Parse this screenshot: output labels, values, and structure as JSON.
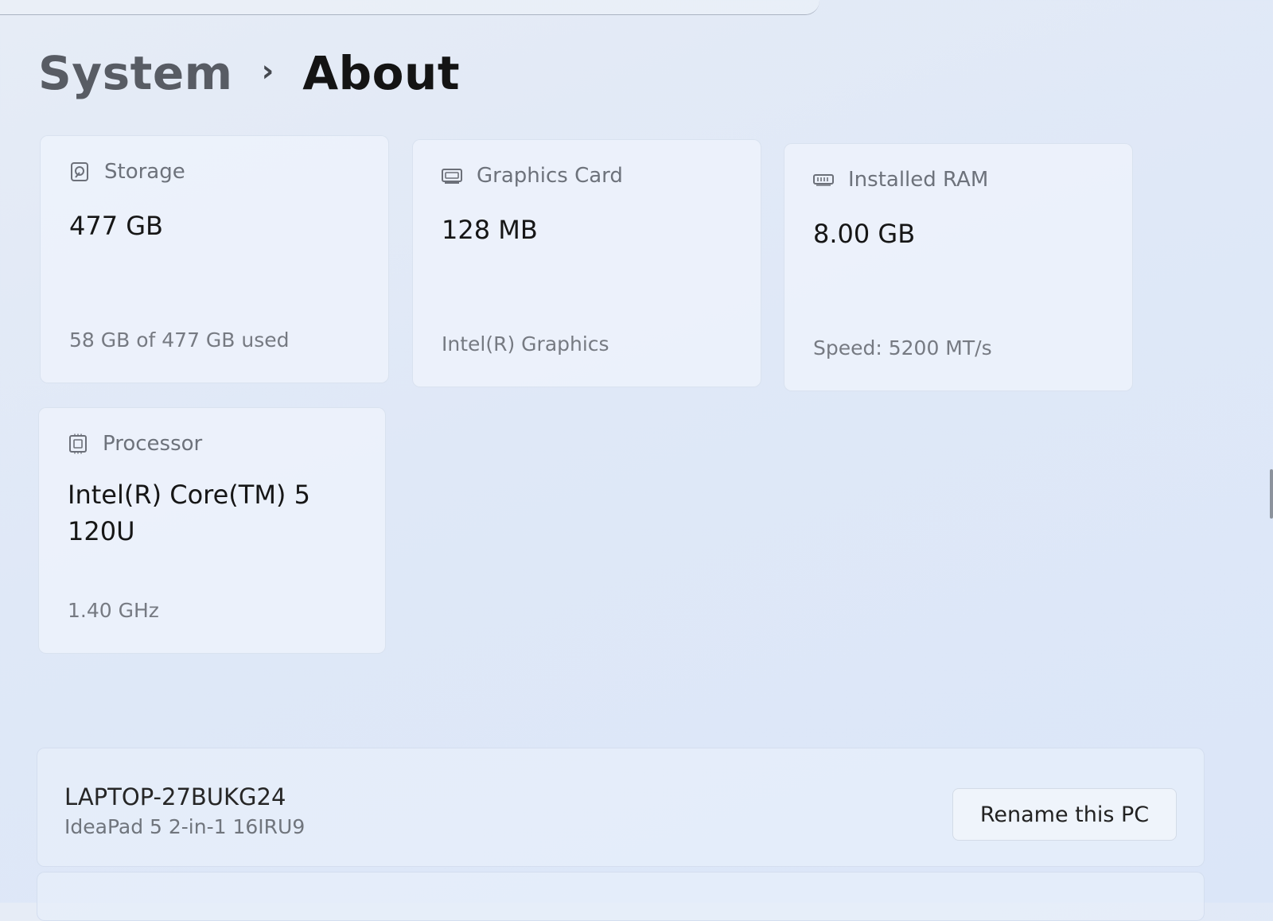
{
  "breadcrumb": {
    "parent": "System",
    "separator": "›",
    "current": "About"
  },
  "specs": {
    "storage": {
      "icon": "storage-icon",
      "title": "Storage",
      "value": "477 GB",
      "detail": "58 GB of 477 GB used"
    },
    "graphics": {
      "icon": "graphics-card-icon",
      "title": "Graphics Card",
      "value": "128 MB",
      "detail": "Intel(R) Graphics"
    },
    "ram": {
      "icon": "ram-icon",
      "title": "Installed RAM",
      "value": "8.00 GB",
      "detail": "Speed: 5200 MT/s"
    },
    "processor": {
      "icon": "processor-icon",
      "title": "Processor",
      "value": "Intel(R) Core(TM) 5 120U",
      "detail": "1.40 GHz"
    }
  },
  "device": {
    "name": "LAPTOP-27BUKG24",
    "model": "IdeaPad 5 2-in-1 16IRU9",
    "rename_label": "Rename this PC"
  }
}
